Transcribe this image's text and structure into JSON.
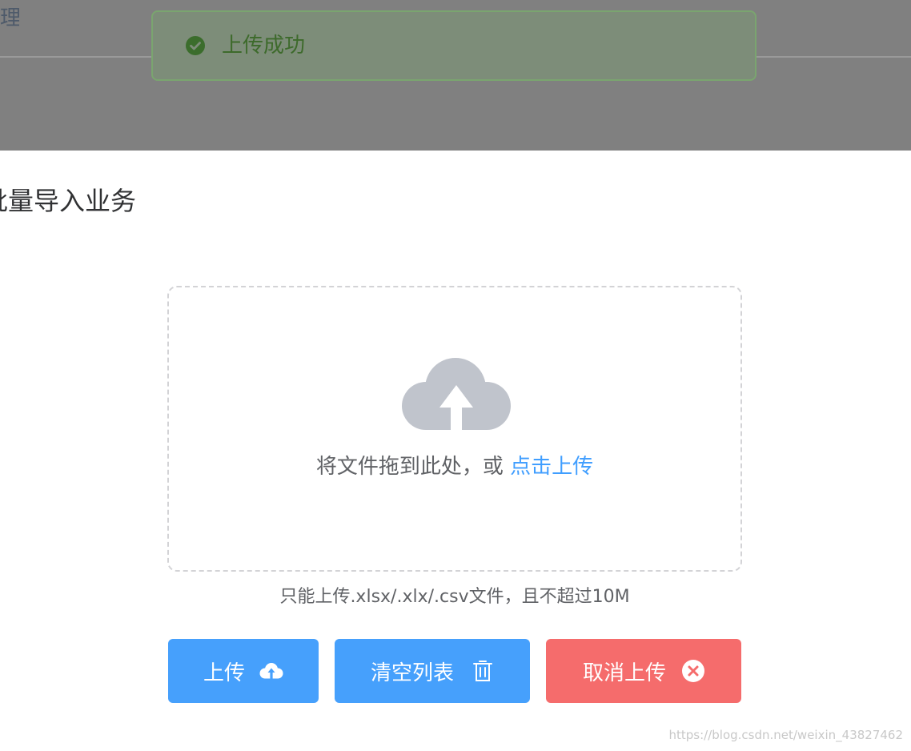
{
  "background": {
    "breadcrumb_fragment": "理"
  },
  "toast": {
    "icon": "check-circle-icon",
    "message": "上传成功"
  },
  "dialog": {
    "title": "批量导入业务",
    "dragger": {
      "icon": "upload-cloud-icon",
      "text": "将文件拖到此处，或 ",
      "link": "点击上传"
    },
    "tip": "只能上传.xlsx/.xlx/.csv文件，且不超过10M",
    "buttons": {
      "upload": "上传",
      "clear": "清空列表",
      "cancel": "取消上传"
    }
  },
  "watermark": "https://blog.csdn.net/weixin_43827462",
  "colors": {
    "primary": "#409eff",
    "danger": "#f56c6c",
    "success": "#67c23a"
  }
}
